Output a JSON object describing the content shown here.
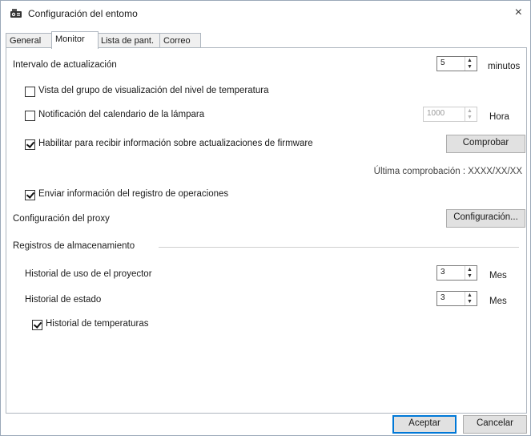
{
  "window": {
    "title": "Configuración del entomo",
    "close_glyph": "×"
  },
  "tabs": [
    {
      "label": "General"
    },
    {
      "label": "Monitor"
    },
    {
      "label": "Lista de pant."
    },
    {
      "label": "Correo"
    }
  ],
  "monitor": {
    "update_interval": {
      "label": "Intervalo de actualización",
      "value": "5",
      "unit": "minutos"
    },
    "temp_group_view": {
      "label": "Vista del grupo de visualización del nivel de temperatura",
      "checked": false
    },
    "lamp_calendar": {
      "label": "Notificación del calendario de la lámpara",
      "checked": false,
      "value": "1000",
      "unit": "Hora"
    },
    "firmware_updates": {
      "label": "Habilitar para recibir información sobre actualizaciones de firmware",
      "checked": true,
      "check_button": "Comprobar"
    },
    "last_check": "Última comprobación : XXXX/XX/XX",
    "send_operation_log": {
      "label": "Enviar información del registro de operaciones",
      "checked": true
    },
    "proxy": {
      "label": "Configuración del proxy",
      "button": "Configuración..."
    }
  },
  "storage": {
    "section_title": "Registros de almacenamiento",
    "usage_history": {
      "label": "Historial de uso de el proyector",
      "value": "3",
      "unit": "Mes"
    },
    "status_history": {
      "label": "Historial de estado",
      "value": "3",
      "unit": "Mes"
    },
    "temperature_history": {
      "label": "Historial de temperaturas",
      "checked": true
    }
  },
  "footer": {
    "ok": "Aceptar",
    "cancel": "Cancelar"
  }
}
